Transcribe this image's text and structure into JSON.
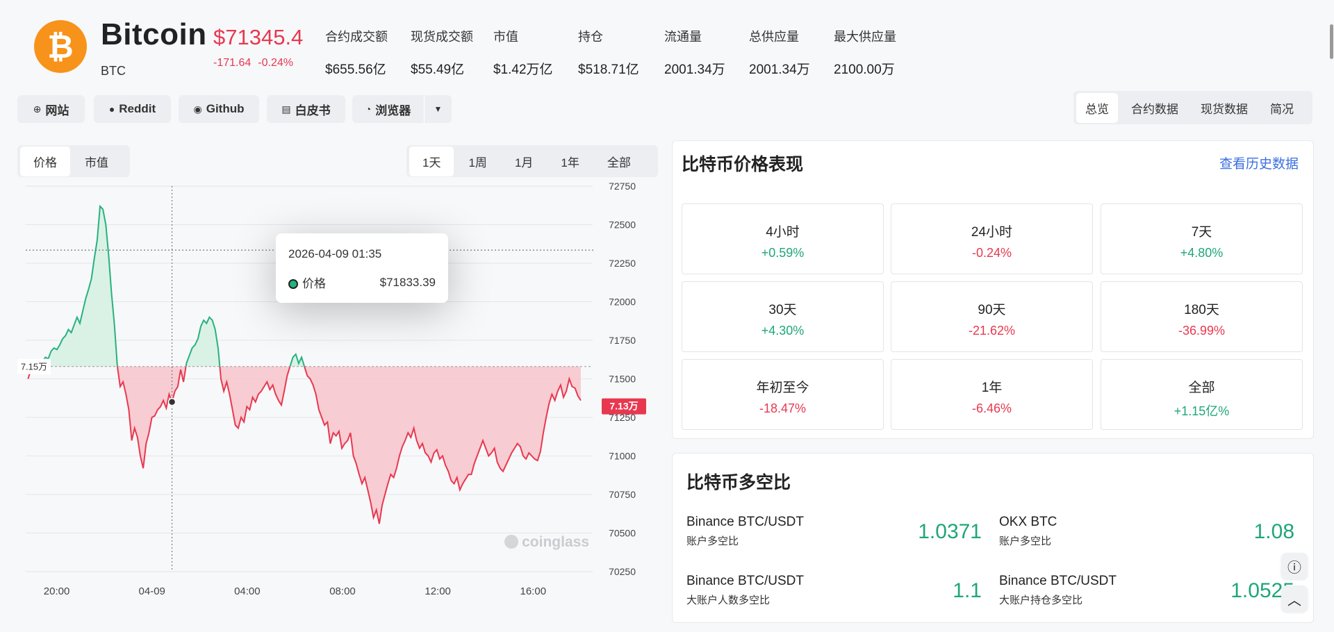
{
  "coin": {
    "logo_glyph": "₿",
    "name": "Bitcoin",
    "symbol": "BTC",
    "price": "$71345.4",
    "change_abs": "-171.64",
    "change_pct": "-0.24%"
  },
  "stats": [
    {
      "label": "合约成交额",
      "value": "$655.56亿"
    },
    {
      "label": "现货成交额",
      "value": "$55.49亿"
    },
    {
      "label": "市值",
      "value": "$1.42万亿"
    },
    {
      "label": "持仓",
      "value": "$518.71亿"
    },
    {
      "label": "流通量",
      "value": "2001.34万"
    },
    {
      "label": "总供应量",
      "value": "2001.34万"
    },
    {
      "label": "最大供应量",
      "value": "2100.00万"
    }
  ],
  "links": [
    {
      "label": "网站",
      "icon": "⊕",
      "icon_name": "globe-icon"
    },
    {
      "label": "Reddit",
      "icon": "●",
      "icon_name": "reddit-icon"
    },
    {
      "label": "Github",
      "icon": "◉",
      "icon_name": "github-icon"
    },
    {
      "label": "白皮书",
      "icon": "▤",
      "icon_name": "document-icon"
    },
    {
      "label": "浏览器",
      "icon": "◔",
      "icon_name": "explorer-icon"
    }
  ],
  "dropdown_icon": "▼",
  "right_tabs": [
    "总览",
    "合约数据",
    "现货数据",
    "简况"
  ],
  "chart_toggle": [
    "价格",
    "市值"
  ],
  "time_ranges": [
    "1天",
    "1周",
    "1月",
    "1年",
    "全部"
  ],
  "chart_data": {
    "type": "area",
    "baseline": 71580,
    "baseline_label": "7.15万",
    "current_label": "7.13万",
    "y_ticks": [
      72750,
      72500,
      72250,
      72000,
      71750,
      71500,
      71250,
      71000,
      70750,
      70500,
      70250
    ],
    "x_ticks": [
      "20:00",
      "04-09",
      "04:00",
      "08:00",
      "12:00",
      "16:00"
    ],
    "x_tick_pos": [
      0.5,
      2.5,
      4.5,
      6.5,
      8.5,
      10.5
    ],
    "ylim": [
      70250,
      72750
    ],
    "xlim": [
      -0.15,
      11.75
    ],
    "highlight_x": 2.95,
    "colors": {
      "up": "#26b27d",
      "down": "#e8384f",
      "up_fill": "#d6f0e3",
      "down_fill": "#f6c6cd"
    },
    "values": [
      71500,
      71560,
      71600,
      71590,
      71620,
      71610,
      71640,
      71630,
      71680,
      71700,
      71690,
      71720,
      71760,
      71780,
      71820,
      71800,
      71850,
      71900,
      71860,
      71940,
      72020,
      72080,
      72150,
      72280,
      72400,
      72620,
      72600,
      72500,
      72300,
      72050,
      71850,
      71580,
      71450,
      71480,
      71400,
      71300,
      71100,
      71180,
      71120,
      71000,
      70920,
      71080,
      71150,
      71250,
      71260,
      71300,
      71320,
      71360,
      71310,
      71400,
      71350,
      71420,
      71450,
      71560,
      71480,
      71600,
      71650,
      71700,
      71720,
      71760,
      71840,
      71880,
      71860,
      71900,
      71880,
      71820,
      71700,
      71500,
      71420,
      71480,
      71400,
      71300,
      71200,
      71180,
      71250,
      71220,
      71320,
      71300,
      71380,
      71350,
      71400,
      71420,
      71450,
      71480,
      71430,
      71460,
      71400,
      71360,
      71330,
      71420,
      71520,
      71580,
      71640,
      71660,
      71600,
      71640,
      71580,
      71520,
      71500,
      71460,
      71400,
      71300,
      71250,
      71200,
      71220,
      71080,
      71150,
      71130,
      71160,
      71050,
      71080,
      71100,
      71150,
      71000,
      70950,
      70880,
      70820,
      70860,
      70780,
      70700,
      70600,
      70650,
      70560,
      70680,
      70750,
      70820,
      70880,
      70860,
      70920,
      71000,
      71060,
      71100,
      71150,
      71120,
      71180,
      71100,
      71050,
      71080,
      71020,
      71000,
      70960,
      71020,
      71040,
      70980,
      71000,
      70940,
      70900,
      70840,
      70820,
      70860,
      70780,
      70820,
      70850,
      70880,
      70880,
      70950,
      71000,
      71050,
      71100,
      71050,
      71000,
      71020,
      71050,
      70960,
      70920,
      70900,
      70940,
      70980,
      71020,
      71050,
      71080,
      71060,
      71000,
      70980,
      71020,
      71000,
      70980,
      70970,
      71030,
      71150,
      71250,
      71340,
      71400,
      71360,
      71420,
      71460,
      71380,
      71420,
      71500,
      71450,
      71440,
      71390,
      71360
    ],
    "watermark": "coinglass"
  },
  "tooltip": {
    "time": "2026-04-09 01:35",
    "label": "价格",
    "value": "$71833.39"
  },
  "performance": {
    "title": "比特币价格表现",
    "history_link": "查看历史数据",
    "cells": [
      {
        "label": "4小时",
        "value": "+0.59%",
        "dir": "pos"
      },
      {
        "label": "24小时",
        "value": "-0.24%",
        "dir": "neg"
      },
      {
        "label": "7天",
        "value": "+4.80%",
        "dir": "pos"
      },
      {
        "label": "30天",
        "value": "+4.30%",
        "dir": "pos"
      },
      {
        "label": "90天",
        "value": "-21.62%",
        "dir": "neg"
      },
      {
        "label": "180天",
        "value": "-36.99%",
        "dir": "neg"
      },
      {
        "label": "年初至今",
        "value": "-18.47%",
        "dir": "neg"
      },
      {
        "label": "1年",
        "value": "-6.46%",
        "dir": "neg"
      },
      {
        "label": "全部",
        "value": "+1.15亿%",
        "dir": "pos"
      }
    ]
  },
  "long_short": {
    "title": "比特币多空比",
    "items": [
      {
        "name": "Binance BTC/USDT",
        "sub": "账户多空比",
        "value": "1.0371"
      },
      {
        "name": "OKX BTC",
        "sub": "账户多空比",
        "value": "1.08"
      },
      {
        "name": "Binance BTC/USDT",
        "sub": "大账户人数多空比",
        "value": "1.1"
      },
      {
        "name": "Binance BTC/USDT",
        "sub": "大账户持仓多空比",
        "value": "1.0525"
      }
    ]
  },
  "fab_icons": {
    "feedback": "ⓘ",
    "back_to_top": "︿"
  }
}
